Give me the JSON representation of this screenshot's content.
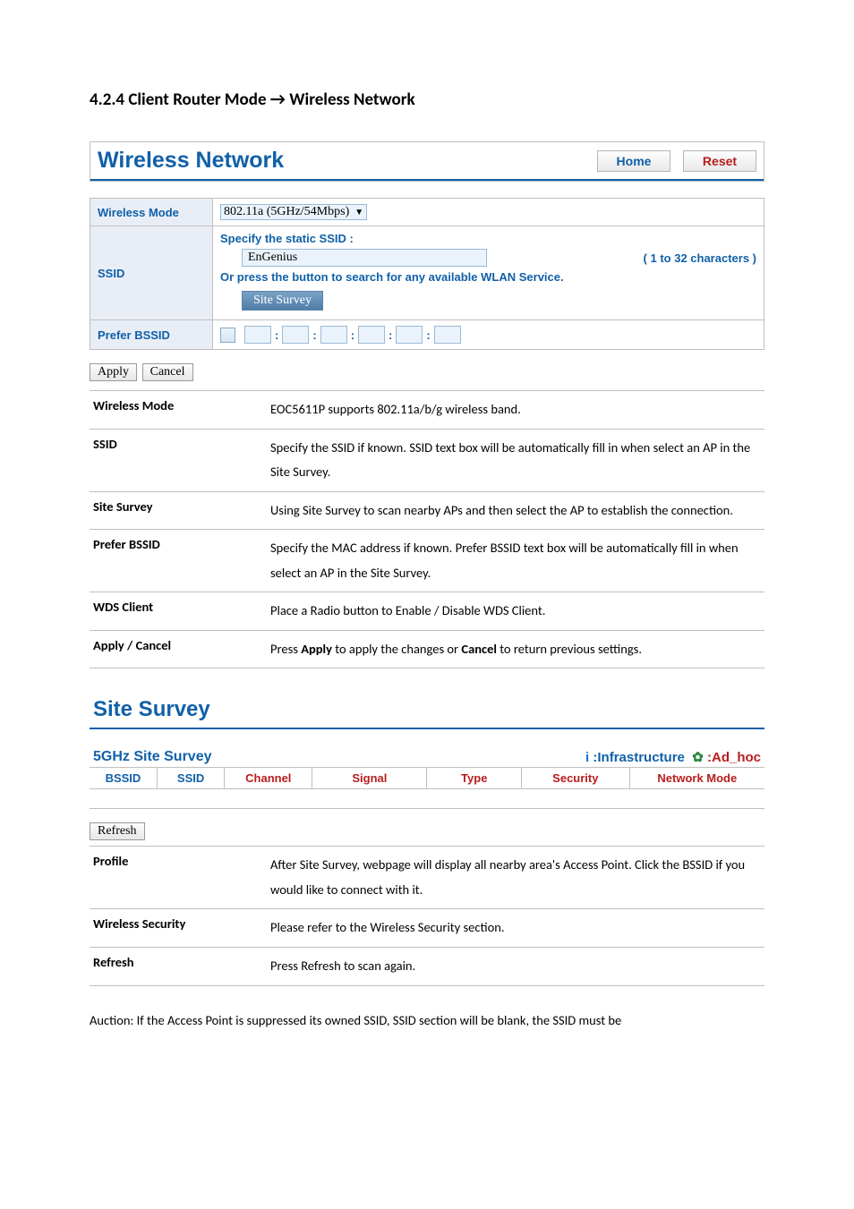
{
  "section_heading": "4.2.4 Client Router Mode → Wireless Network",
  "panel1": {
    "title": "Wireless Network",
    "home": "Home",
    "reset": "Reset",
    "rows": {
      "wireless_mode_label": "Wireless Mode",
      "wireless_mode_value": "802.11a (5GHz/54Mbps)",
      "ssid_label": "SSID",
      "ssid_caption1": "Specify the static SSID  :",
      "ssid_value": "EnGenius",
      "ssid_hint": "( 1 to 32 characters )",
      "ssid_caption2": "Or press the button to search for any available WLAN Service.",
      "site_survey_btn": "Site Survey",
      "prefer_bssid_label": "Prefer BSSID"
    },
    "apply": "Apply",
    "cancel": "Cancel"
  },
  "desc1": [
    {
      "k": "Wireless Mode",
      "v": "EOC5611P supports 802.11a/b/g wireless band."
    },
    {
      "k": "SSID",
      "v": "Specify the SSID if known. SSID text box will be automatically fill in when select an AP in the Site Survey."
    },
    {
      "k": "Site Survey",
      "v": "Using Site Survey to scan nearby APs and then select the AP to establish the connection."
    },
    {
      "k": "Prefer BSSID",
      "v": "Specify the MAC address if known. Prefer BSSID text box will be automatically fill in when select an AP in the Site Survey."
    },
    {
      "k": "WDS Client",
      "v": "Place a Radio button to Enable / Disable WDS Client."
    },
    {
      "k": "Apply / Cancel",
      "v_pre": "Press ",
      "v_b1": "Apply",
      "v_mid": " to apply the changes or ",
      "v_b2": "Cancel",
      "v_post": " to return previous settings."
    }
  ],
  "panel2": {
    "title": "Site Survey",
    "sub": "5GHz Site Survey",
    "legend_left": ":Infrastructure",
    "legend_right": ":Ad_hoc",
    "cols": [
      "BSSID",
      "SSID",
      "Channel",
      "Signal",
      "Type",
      "Security",
      "Network Mode"
    ],
    "refresh": "Refresh"
  },
  "desc2": [
    {
      "k": "Profile",
      "v": "After Site Survey, webpage will display all nearby area's Access Point. Click the BSSID if you would like to connect with it."
    },
    {
      "k": "Wireless Security",
      "v": "Please refer to the Wireless Security section."
    },
    {
      "k": "Refresh",
      "v": "Press Refresh to scan again."
    }
  ],
  "trailing": "Auction: If the Access Point is suppressed its owned SSID, SSID section will be blank, the SSID must be"
}
